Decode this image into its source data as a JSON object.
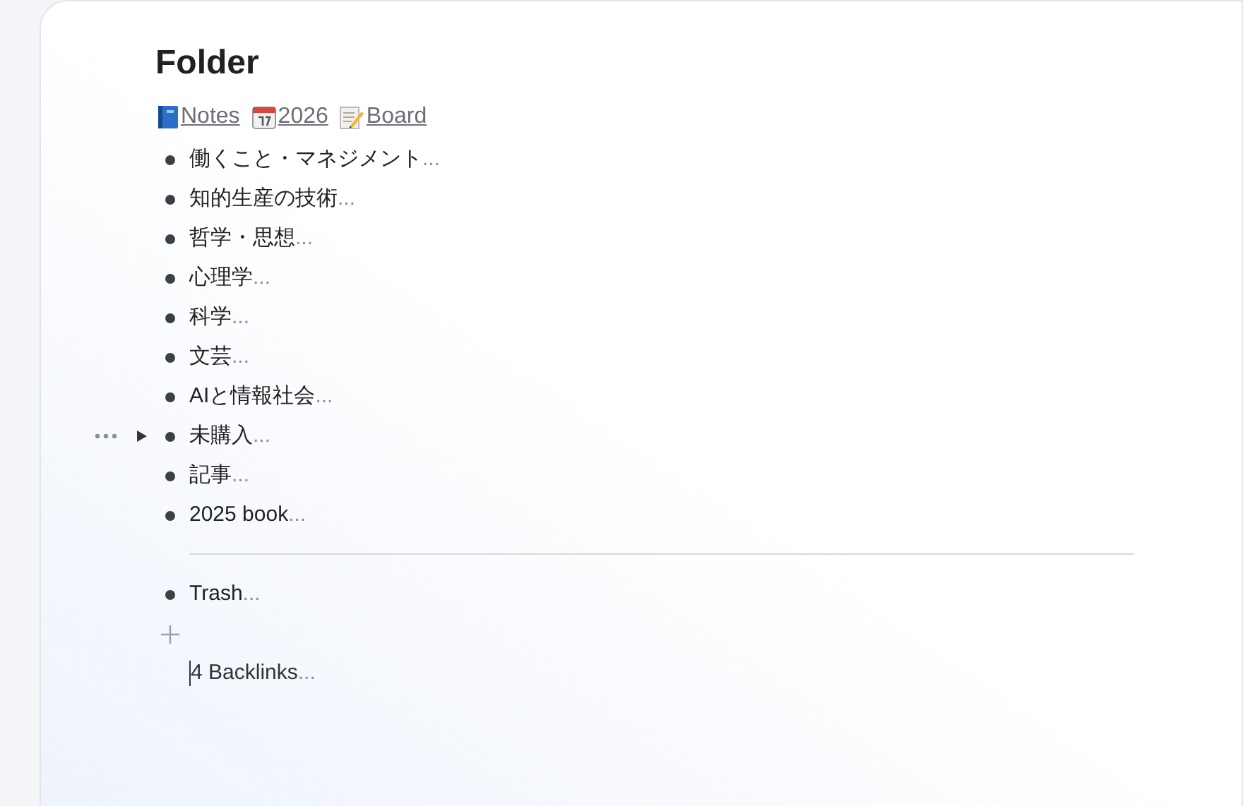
{
  "title": "Folder",
  "links": [
    {
      "kind": "book",
      "label": "Notes"
    },
    {
      "kind": "calendar",
      "label": "2026"
    },
    {
      "kind": "memo",
      "label": "Board"
    }
  ],
  "items": [
    {
      "label": "働くこと・マネジメント",
      "more": "...",
      "hovered": false
    },
    {
      "label": "知的生産の技術",
      "more": "...",
      "hovered": false
    },
    {
      "label": "哲学・思想",
      "more": "...",
      "hovered": false
    },
    {
      "label": "心理学",
      "more": "...",
      "hovered": false
    },
    {
      "label": "科学",
      "more": "...",
      "hovered": false
    },
    {
      "label": "文芸",
      "more": "...",
      "hovered": false
    },
    {
      "label": "AIと情報社会",
      "more": "...",
      "hovered": false
    },
    {
      "label": "未購入",
      "more": "...",
      "hovered": true
    },
    {
      "label": "記事",
      "more": "...",
      "hovered": false
    },
    {
      "label": "2025 book",
      "more": "...",
      "hovered": false
    }
  ],
  "trash": {
    "label": "Trash",
    "more": "..."
  },
  "backlinks": {
    "label": "4 Backlinks",
    "more": "..."
  }
}
